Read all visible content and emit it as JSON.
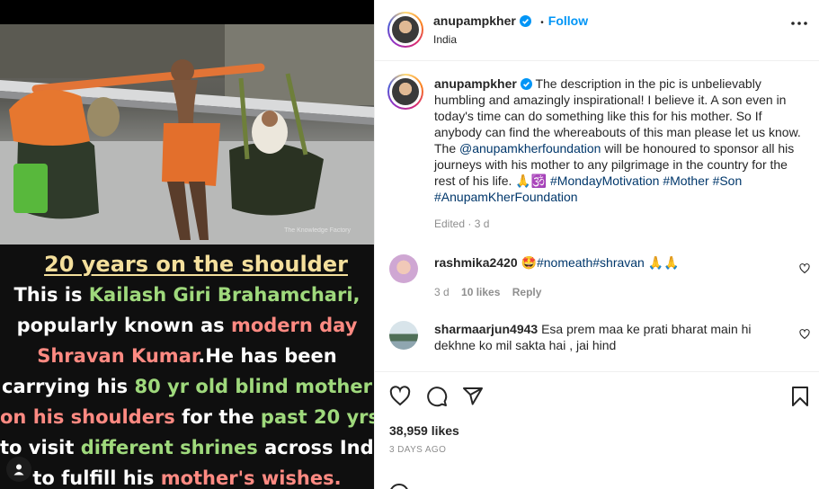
{
  "media": {
    "watermark": "The Knowledge Factory",
    "title": "20 years on the shoulder",
    "lines": [
      [
        {
          "t": "This is  ",
          "c": ""
        },
        {
          "t": "Kailash Giri Brahamchari,",
          "c": "c-green"
        }
      ],
      [
        {
          "t": "popularly known as ",
          "c": ""
        },
        {
          "t": "modern day",
          "c": "c-pink"
        }
      ],
      [
        {
          "t": "Shravan Kumar",
          "c": "c-pink"
        },
        {
          "t": ".He has been",
          "c": ""
        }
      ],
      [
        {
          "t": "carrying his  ",
          "c": ""
        },
        {
          "t": "80 yr old blind mother",
          "c": "c-green"
        }
      ],
      [
        {
          "t": "on his shoulders",
          "c": "c-pink"
        },
        {
          "t": " for the  ",
          "c": ""
        },
        {
          "t": "past 20 yrs",
          "c": "c-green"
        }
      ],
      [
        {
          "t": "to visit ",
          "c": ""
        },
        {
          "t": "different shrines",
          "c": "c-green"
        },
        {
          "t": " across India",
          "c": ""
        }
      ],
      [
        {
          "t": "to fulfill his ",
          "c": ""
        },
        {
          "t": "mother's wishes.",
          "c": "c-pink"
        }
      ]
    ]
  },
  "header": {
    "username": "anupampkher",
    "follow": "Follow",
    "separator": "•",
    "location": "India"
  },
  "caption": {
    "username": "anupampkher",
    "text_1": "The description in the pic is unbelievably humbling and amazingly inspirational! I believe it. A son even in today's time can do something like this for his mother. So If anybody can find the whereabouts of this man please let us know. The ",
    "mention": "@anupamkherfoundation",
    "text_2": " will be honoured to sponsor all his journeys with his mother to any pilgrimage in the country for the rest of his life. 🙏🕉️ ",
    "hashtag_1": "#MondayMotivation",
    "hashtag_2": "#Mother",
    "hashtag_3": "#Son",
    "hashtag_4": "#AnupamKherFoundation",
    "meta": "Edited · 3 d"
  },
  "comments": [
    {
      "username": "rashmika2420",
      "emoji": "🤩",
      "hashtag_1": "#nomeath",
      "hashtag_2": "#shravan",
      "emoji_end": "🙏🙏",
      "time": "3 d",
      "likes": "10 likes",
      "reply": "Reply"
    },
    {
      "username": "sharmaarjun4943",
      "text": "Esa prem maa ke prati bharat main hi dekhne ko mil sakta hai , jai hind"
    }
  ],
  "actions": {
    "likes": "38,959 likes",
    "date": "3 DAYS AGO"
  },
  "colors": {
    "follow": "#0095f6",
    "link": "#00376b",
    "meta": "#8e8e8e",
    "caption_green": "#9fd97c",
    "caption_pink": "#ff8a82",
    "caption_title": "#f4df9c"
  }
}
